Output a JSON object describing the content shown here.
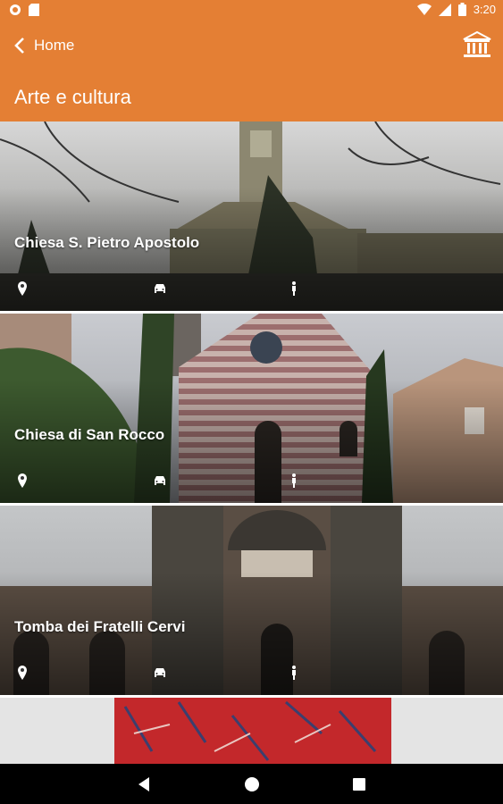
{
  "status_bar": {
    "time": "3:20",
    "left_icons": [
      "notification-icon",
      "sim-card-icon"
    ],
    "right_icons": [
      "wifi-icon",
      "signal-icon",
      "battery-icon"
    ]
  },
  "app_bar": {
    "back_label": "Home",
    "section_title": "Arte e cultura",
    "action_icon": "museum-icon"
  },
  "colors": {
    "primary": "#e47f34",
    "text_on_primary": "#ffffff"
  },
  "cards": [
    {
      "title": "Chiesa S. Pietro Apostolo",
      "icons": [
        "location-pin-icon",
        "car-icon",
        "pedestrian-icon"
      ]
    },
    {
      "title": "Chiesa di San Rocco",
      "icons": [
        "location-pin-icon",
        "car-icon",
        "pedestrian-icon"
      ]
    },
    {
      "title": "Tomba dei Fratelli Cervi",
      "icons": [
        "location-pin-icon",
        "car-icon",
        "pedestrian-icon"
      ]
    }
  ],
  "nav_bar": {
    "buttons": [
      "back-icon",
      "home-icon",
      "recents-icon"
    ]
  }
}
